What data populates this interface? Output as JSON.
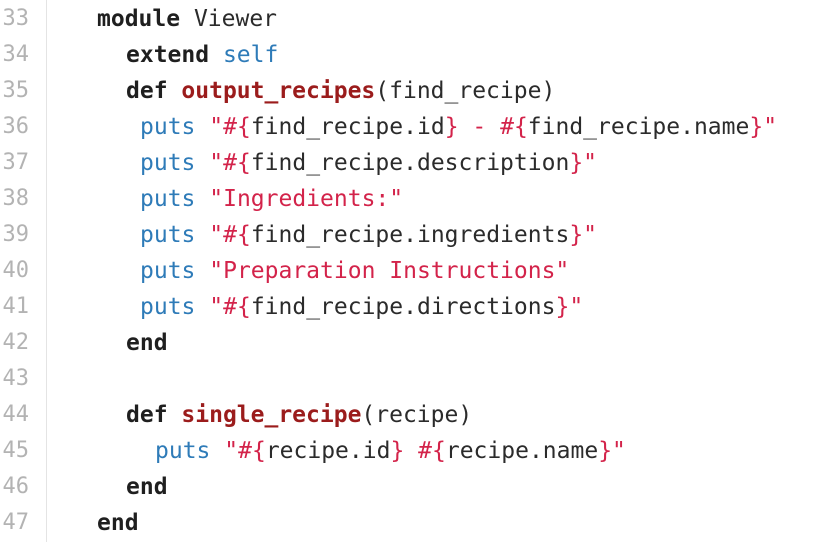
{
  "lines": [
    {
      "no": "33",
      "tokens": [
        [
          "kw",
          "module"
        ],
        [
          "plain",
          " Viewer"
        ]
      ]
    },
    {
      "no": "34",
      "tokens": [
        [
          "kw",
          "extend"
        ],
        [
          "plain",
          " "
        ],
        [
          "slf",
          "self"
        ]
      ]
    },
    {
      "no": "35",
      "tokens": [
        [
          "kw",
          "def"
        ],
        [
          "plain",
          " "
        ],
        [
          "fn",
          "output_recipes"
        ],
        [
          "plain",
          "(find_recipe)"
        ]
      ]
    },
    {
      "no": "36",
      "tokens": [
        [
          "mth",
          "puts"
        ],
        [
          "plain",
          " "
        ],
        [
          "str",
          "\""
        ],
        [
          "intp",
          "#{"
        ],
        [
          "plain",
          "find_recipe.id"
        ],
        [
          "intp",
          "}"
        ],
        [
          "str",
          " - "
        ],
        [
          "intp",
          "#{"
        ],
        [
          "plain",
          "find_recipe.name"
        ],
        [
          "intp",
          "}"
        ],
        [
          "str",
          "\""
        ]
      ]
    },
    {
      "no": "37",
      "tokens": [
        [
          "mth",
          "puts"
        ],
        [
          "plain",
          " "
        ],
        [
          "str",
          "\""
        ],
        [
          "intp",
          "#{"
        ],
        [
          "plain",
          "find_recipe.description"
        ],
        [
          "intp",
          "}"
        ],
        [
          "str",
          "\""
        ]
      ]
    },
    {
      "no": "38",
      "tokens": [
        [
          "mth",
          "puts"
        ],
        [
          "plain",
          " "
        ],
        [
          "str",
          "\"Ingredients:\""
        ]
      ]
    },
    {
      "no": "39",
      "tokens": [
        [
          "mth",
          "puts"
        ],
        [
          "plain",
          " "
        ],
        [
          "str",
          "\""
        ],
        [
          "intp",
          "#{"
        ],
        [
          "plain",
          "find_recipe.ingredients"
        ],
        [
          "intp",
          "}"
        ],
        [
          "str",
          "\""
        ]
      ]
    },
    {
      "no": "40",
      "tokens": [
        [
          "mth",
          "puts"
        ],
        [
          "plain",
          " "
        ],
        [
          "str",
          "\"Preparation Instructions\""
        ]
      ]
    },
    {
      "no": "41",
      "tokens": [
        [
          "mth",
          "puts"
        ],
        [
          "plain",
          " "
        ],
        [
          "str",
          "\""
        ],
        [
          "intp",
          "#{"
        ],
        [
          "plain",
          "find_recipe.directions"
        ],
        [
          "intp",
          "}"
        ],
        [
          "str",
          "\""
        ]
      ]
    },
    {
      "no": "42",
      "tokens": [
        [
          "kw",
          "end"
        ]
      ]
    },
    {
      "no": "43",
      "tokens": []
    },
    {
      "no": "44",
      "tokens": [
        [
          "kw",
          "def"
        ],
        [
          "plain",
          " "
        ],
        [
          "fn",
          "single_recipe"
        ],
        [
          "plain",
          "(recipe)"
        ]
      ]
    },
    {
      "no": "45",
      "tokens": [
        [
          "mth",
          "puts"
        ],
        [
          "plain",
          " "
        ],
        [
          "str",
          "\""
        ],
        [
          "intp",
          "#{"
        ],
        [
          "plain",
          "recipe.id"
        ],
        [
          "intp",
          "}"
        ],
        [
          "str",
          " "
        ],
        [
          "intp",
          "#{"
        ],
        [
          "plain",
          "recipe.name"
        ],
        [
          "intp",
          "}"
        ],
        [
          "str",
          "\""
        ]
      ]
    },
    {
      "no": "46",
      "tokens": [
        [
          "kw",
          "end"
        ]
      ]
    },
    {
      "no": "47",
      "tokens": [
        [
          "kw",
          "end"
        ]
      ]
    }
  ],
  "colors": {
    "keyword": "#1f1f1f",
    "function_name": "#9b1c1c",
    "method": "#2e7bb8",
    "string": "#d3234a",
    "line_number": "#b3b3b3"
  }
}
